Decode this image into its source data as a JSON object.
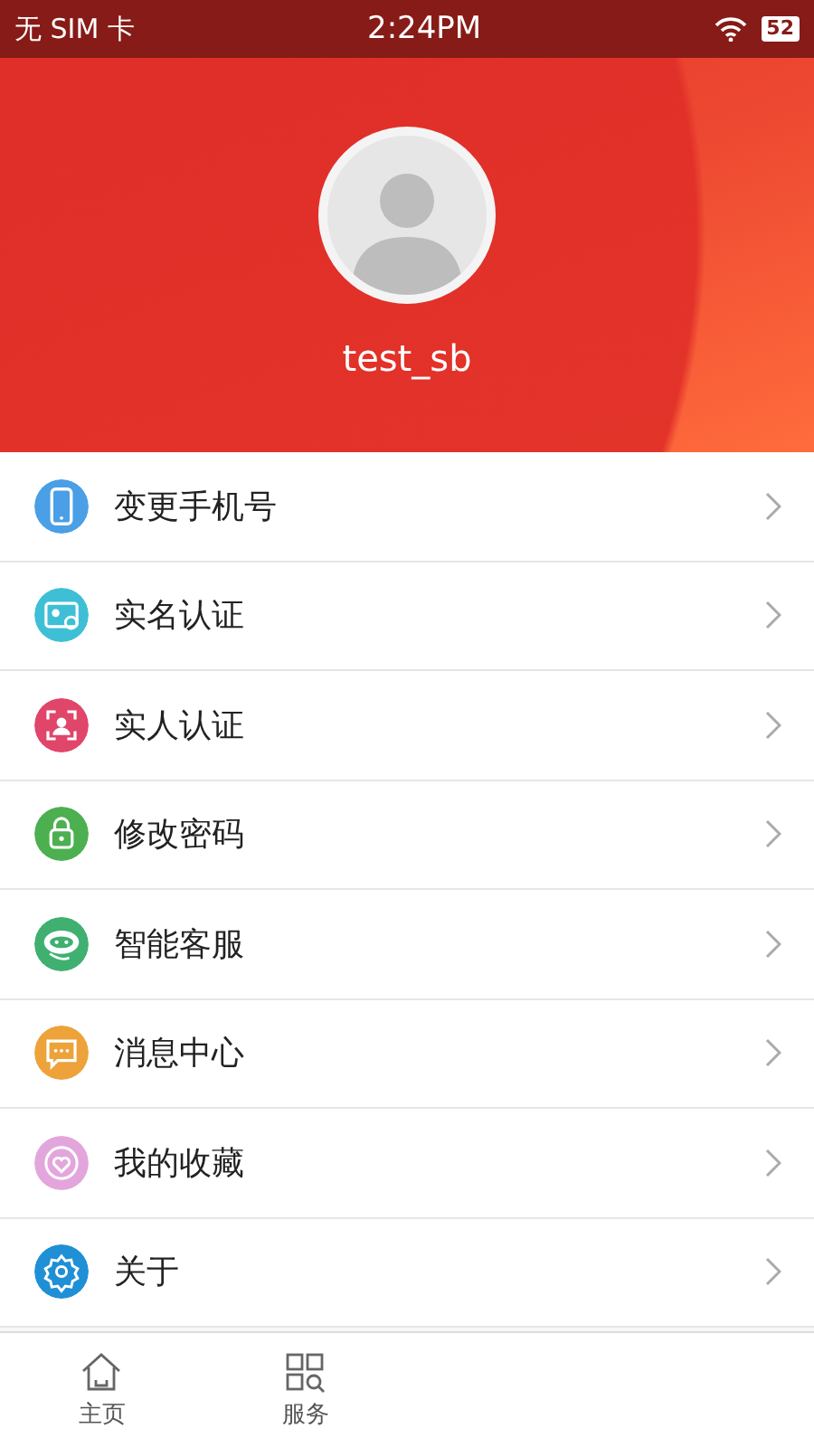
{
  "status_bar": {
    "carrier": "无 SIM 卡",
    "time": "2:24PM",
    "battery": "52"
  },
  "profile": {
    "username": "test_sb"
  },
  "menu": [
    {
      "label": "变更手机号",
      "kind": "phone",
      "color": "#4a9fe6"
    },
    {
      "label": "实名认证",
      "kind": "idcard",
      "color": "#3fbfd6"
    },
    {
      "label": "实人认证",
      "kind": "face",
      "color": "#e0456a"
    },
    {
      "label": "修改密码",
      "kind": "lock",
      "color": "#4cb050"
    },
    {
      "label": "智能客服",
      "kind": "robot",
      "color": "#3fb070"
    },
    {
      "label": "消息中心",
      "kind": "message",
      "color": "#eda23a"
    },
    {
      "label": "我的收藏",
      "kind": "heart",
      "color": "#e3a6dc"
    },
    {
      "label": "关于",
      "kind": "gear",
      "color": "#1f8fd6"
    }
  ],
  "tab_bar": [
    {
      "label": "主页",
      "kind": "home"
    },
    {
      "label": "服务",
      "kind": "grid"
    }
  ]
}
